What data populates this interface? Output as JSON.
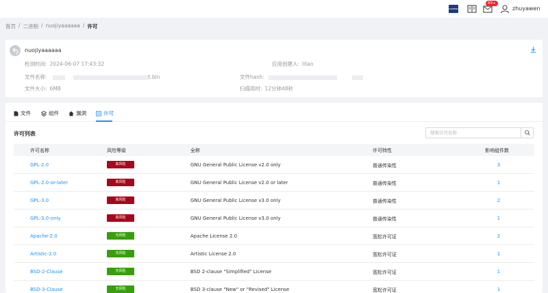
{
  "header": {
    "brand_text": "CUMMINS 康明斯",
    "badge": "99+",
    "username": "zhuyawen"
  },
  "breadcrumb": [
    "首页",
    "/",
    "二进制",
    "/",
    "nuojiyaaaaaa",
    "/",
    "许可"
  ],
  "project": {
    "name": "nuojiyaaaaaa",
    "fields": [
      {
        "label": "检测时间:",
        "value": "2024-06-07 17:43:32"
      },
      {
        "label": "应用创建人:",
        "value": "litao"
      },
      {
        "label": "文件名称:",
        "value": "t.bin"
      },
      {
        "label": "文件hash:",
        "value": ""
      },
      {
        "label": "文件大小:",
        "value": "6MB"
      },
      {
        "label": "扫描用时:",
        "value": "12分钟48秒"
      }
    ]
  },
  "tabs": [
    {
      "label": "文件",
      "icon": "file-icon"
    },
    {
      "label": "组件",
      "icon": "component-icon"
    },
    {
      "label": "漏洞",
      "icon": "home-icon"
    },
    {
      "label": "许可",
      "icon": "license-icon",
      "active": true
    }
  ],
  "section_title": "许可列表",
  "search": {
    "placeholder": "搜索许可名称"
  },
  "table": {
    "columns": [
      "许可名称",
      "风险等级",
      "全称",
      "许可特性",
      "影响组件数"
    ],
    "rows": [
      {
        "name": "GPL-2.0",
        "risk": "高风险",
        "level": "high",
        "full": "GNU General Public License v2.0 only",
        "feature": "普通传染性",
        "count": "3"
      },
      {
        "name": "GPL-2.0-or-later",
        "risk": "高风险",
        "level": "high",
        "full": "GNU General Public License v2.0 or later",
        "feature": "普通传染性",
        "count": "1"
      },
      {
        "name": "GPL-3.0",
        "risk": "高风险",
        "level": "high",
        "full": "GNU General Public License v3.0 only",
        "feature": "普通传染性",
        "count": "2"
      },
      {
        "name": "GPL-3.0-only",
        "risk": "高风险",
        "level": "high",
        "full": "GNU General Public License v3.0 only",
        "feature": "普通传染性",
        "count": "1"
      },
      {
        "name": "Apache-2.0",
        "risk": "无风险",
        "level": "none",
        "full": "Apache License 2.0",
        "feature": "宽松许可证",
        "count": "2"
      },
      {
        "name": "Artistic-2.0",
        "risk": "无风险",
        "level": "none",
        "full": "Artistic License 2.0",
        "feature": "宽松许可证",
        "count": "1"
      },
      {
        "name": "BSD-2-Clause",
        "risk": "无风险",
        "level": "none",
        "full": "BSD 2-clause \"Simplified\" License",
        "feature": "宽松许可证",
        "count": "1"
      },
      {
        "name": "BSD-3-Clause",
        "risk": "无风险",
        "level": "none",
        "full": "BSD 3-clause \"New\" or \"Revised\" License",
        "feature": "宽松许可证",
        "count": "1"
      }
    ]
  },
  "colors": {
    "accent": "#1890ff",
    "high_risk": "#a8071a",
    "no_risk": "#389e0d"
  }
}
